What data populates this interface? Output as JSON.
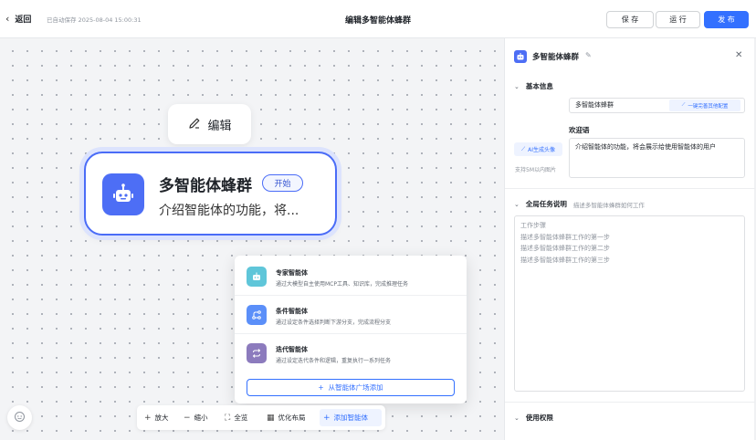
{
  "header": {
    "back_label": "返回",
    "autosave": "已自动保存 2025-08-04 15:00:31",
    "title": "编辑多智能体蜂群",
    "save_label": "保 存",
    "run_label": "运 行",
    "publish_label": "发 布"
  },
  "canvas": {
    "edit_label": "编辑",
    "node": {
      "name": "多智能体蜂群",
      "tag": "开始",
      "description": "介绍智能体的功能，将..."
    },
    "popup": {
      "items": [
        {
          "name": "专家智能体",
          "desc": "通过大模型自主使用MCP工具、知识库，完成推理任务",
          "icon": "robot-icon",
          "color": "#5fc6d9"
        },
        {
          "name": "条件智能体",
          "desc": "通过设定条件选择判断下游分支，完成流程分支",
          "icon": "branch-icon",
          "color": "#5b8ff9"
        },
        {
          "name": "迭代智能体",
          "desc": "通过设定迭代条件和逻辑，重复执行一系列任务",
          "icon": "loop-icon",
          "color": "#8c7bbd"
        }
      ],
      "add_label": "从智能体广场添加"
    },
    "toolbar": {
      "zoom_in": "放大",
      "zoom_out": "缩小",
      "fit": "全览",
      "layout": "优化布局",
      "add_agent": "添加智能体"
    }
  },
  "panel": {
    "title": "多智能体蜂群",
    "basic_info": {
      "heading": "基本信息",
      "name_value": "多智能体蜂群",
      "one_click_label": "一键完善其他配置",
      "welcome_label": "欢迎语",
      "welcome_value": "介绍智能体的功能，将会展示给使用智能体的用户",
      "ai_avatar_label": "AI生成头像",
      "upload_hint": "支持5M以内图片"
    },
    "global_task": {
      "heading": "全局任务说明",
      "subheading": "描述多智能体蜂群如何工作",
      "lines": [
        "工作步骤",
        "描述多智能体蜂群工作的第一步",
        "描述多智能体蜂群工作的第二步",
        "描述多智能体蜂群工作的第三步"
      ]
    },
    "permissions": {
      "heading": "使用权限"
    }
  },
  "colors": {
    "primary": "#3370ff",
    "node_border": "#4a6cf7",
    "avatar": "#4d6ef5"
  }
}
